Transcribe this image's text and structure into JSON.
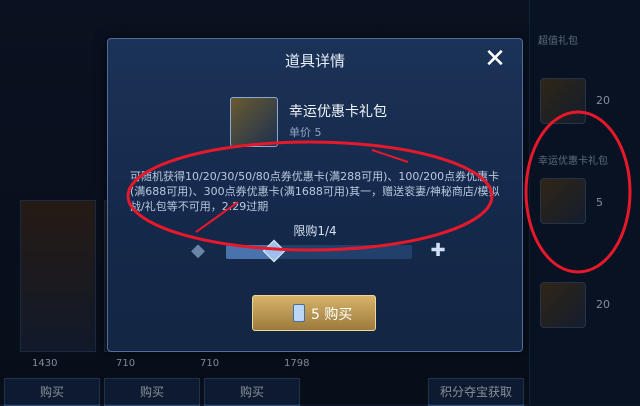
{
  "modal": {
    "title": "道具详情",
    "item_name": "幸运优惠卡礼包",
    "unit_price_label": "单价 5",
    "description": "可随机获得10/20/30/50/80点券优惠卡(满288可用)、100/200点券优惠卡(满688可用)、300点券优惠卡(满1688可用)其一，赠送衮妻/神秘商店/模拟战/礼包等不可用，2.29过期",
    "limit_label": "限购1/4",
    "limit_current": 1,
    "limit_max": 4,
    "buy_button": "5 购买"
  },
  "background": {
    "card_prices": [
      "1430",
      "710",
      "710",
      "1798"
    ],
    "bottom_buttons": [
      "购买",
      "购买",
      "购买",
      "积分夺宝获取"
    ]
  },
  "sidebar": {
    "items": [
      {
        "label": "超值礼包",
        "price": "20"
      },
      {
        "label": "幸运优惠卡礼包",
        "price": "5"
      },
      {
        "label": "",
        "price": "20"
      }
    ]
  },
  "colors": {
    "annotation": "#e6192b",
    "buy_gold": "#d8b46a"
  }
}
